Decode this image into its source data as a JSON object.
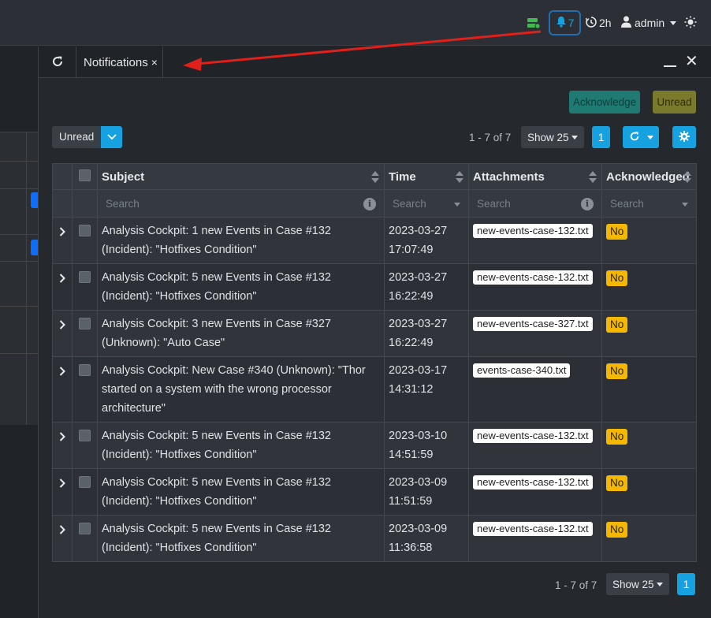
{
  "topbar": {
    "notification_count": "7",
    "timer": "2h",
    "user": "admin"
  },
  "panel": {
    "tab_title": "Notifications",
    "tab_close": "×",
    "window_close": "✕"
  },
  "actions": {
    "acknowledge": "Acknowledge",
    "unread": "Unread"
  },
  "filter": {
    "selected": "Unread"
  },
  "pager": {
    "range": "1 - 7 of 7",
    "show": "Show 25",
    "page": "1"
  },
  "table": {
    "columns": [
      "Subject",
      "Time",
      "Attachments",
      "Acknowledged"
    ],
    "search_placeholder": "Search",
    "rows": [
      {
        "subject": "Analysis Cockpit: 1 new Events in Case #132 (Incident): \"Hotfixes Condition\"",
        "time": "2023-03-27 17:07:49",
        "attachment": "new-events-case-132.txt",
        "ack": "No"
      },
      {
        "subject": "Analysis Cockpit: 5 new Events in Case #132 (Incident): \"Hotfixes Condition\"",
        "time": "2023-03-27 16:22:49",
        "attachment": "new-events-case-132.txt",
        "ack": "No"
      },
      {
        "subject": "Analysis Cockpit: 3 new Events in Case #327 (Unknown): \"Auto Case\"",
        "time": "2023-03-27 16:22:49",
        "attachment": "new-events-case-327.txt",
        "ack": "No"
      },
      {
        "subject": "Analysis Cockpit: New Case #340 (Unknown): \"Thor started on a system with the wrong processor architecture\"",
        "time": "2023-03-17 14:31:12",
        "attachment": "events-case-340.txt",
        "ack": "No"
      },
      {
        "subject": "Analysis Cockpit: 5 new Events in Case #132 (Incident): \"Hotfixes Condition\"",
        "time": "2023-03-10 14:51:59",
        "attachment": "new-events-case-132.txt",
        "ack": "No"
      },
      {
        "subject": "Analysis Cockpit: 5 new Events in Case #132 (Incident): \"Hotfixes Condition\"",
        "time": "2023-03-09 11:51:59",
        "attachment": "new-events-case-132.txt",
        "ack": "No"
      },
      {
        "subject": "Analysis Cockpit: 5 new Events in Case #132 (Incident): \"Hotfixes Condition\"",
        "time": "2023-03-09 11:36:58",
        "attachment": "new-events-case-132.txt",
        "ack": "No"
      }
    ]
  },
  "colors": {
    "accent": "#16a2e0",
    "badge_no": "#f5b800",
    "annotation_arrow": "#e0201a"
  }
}
